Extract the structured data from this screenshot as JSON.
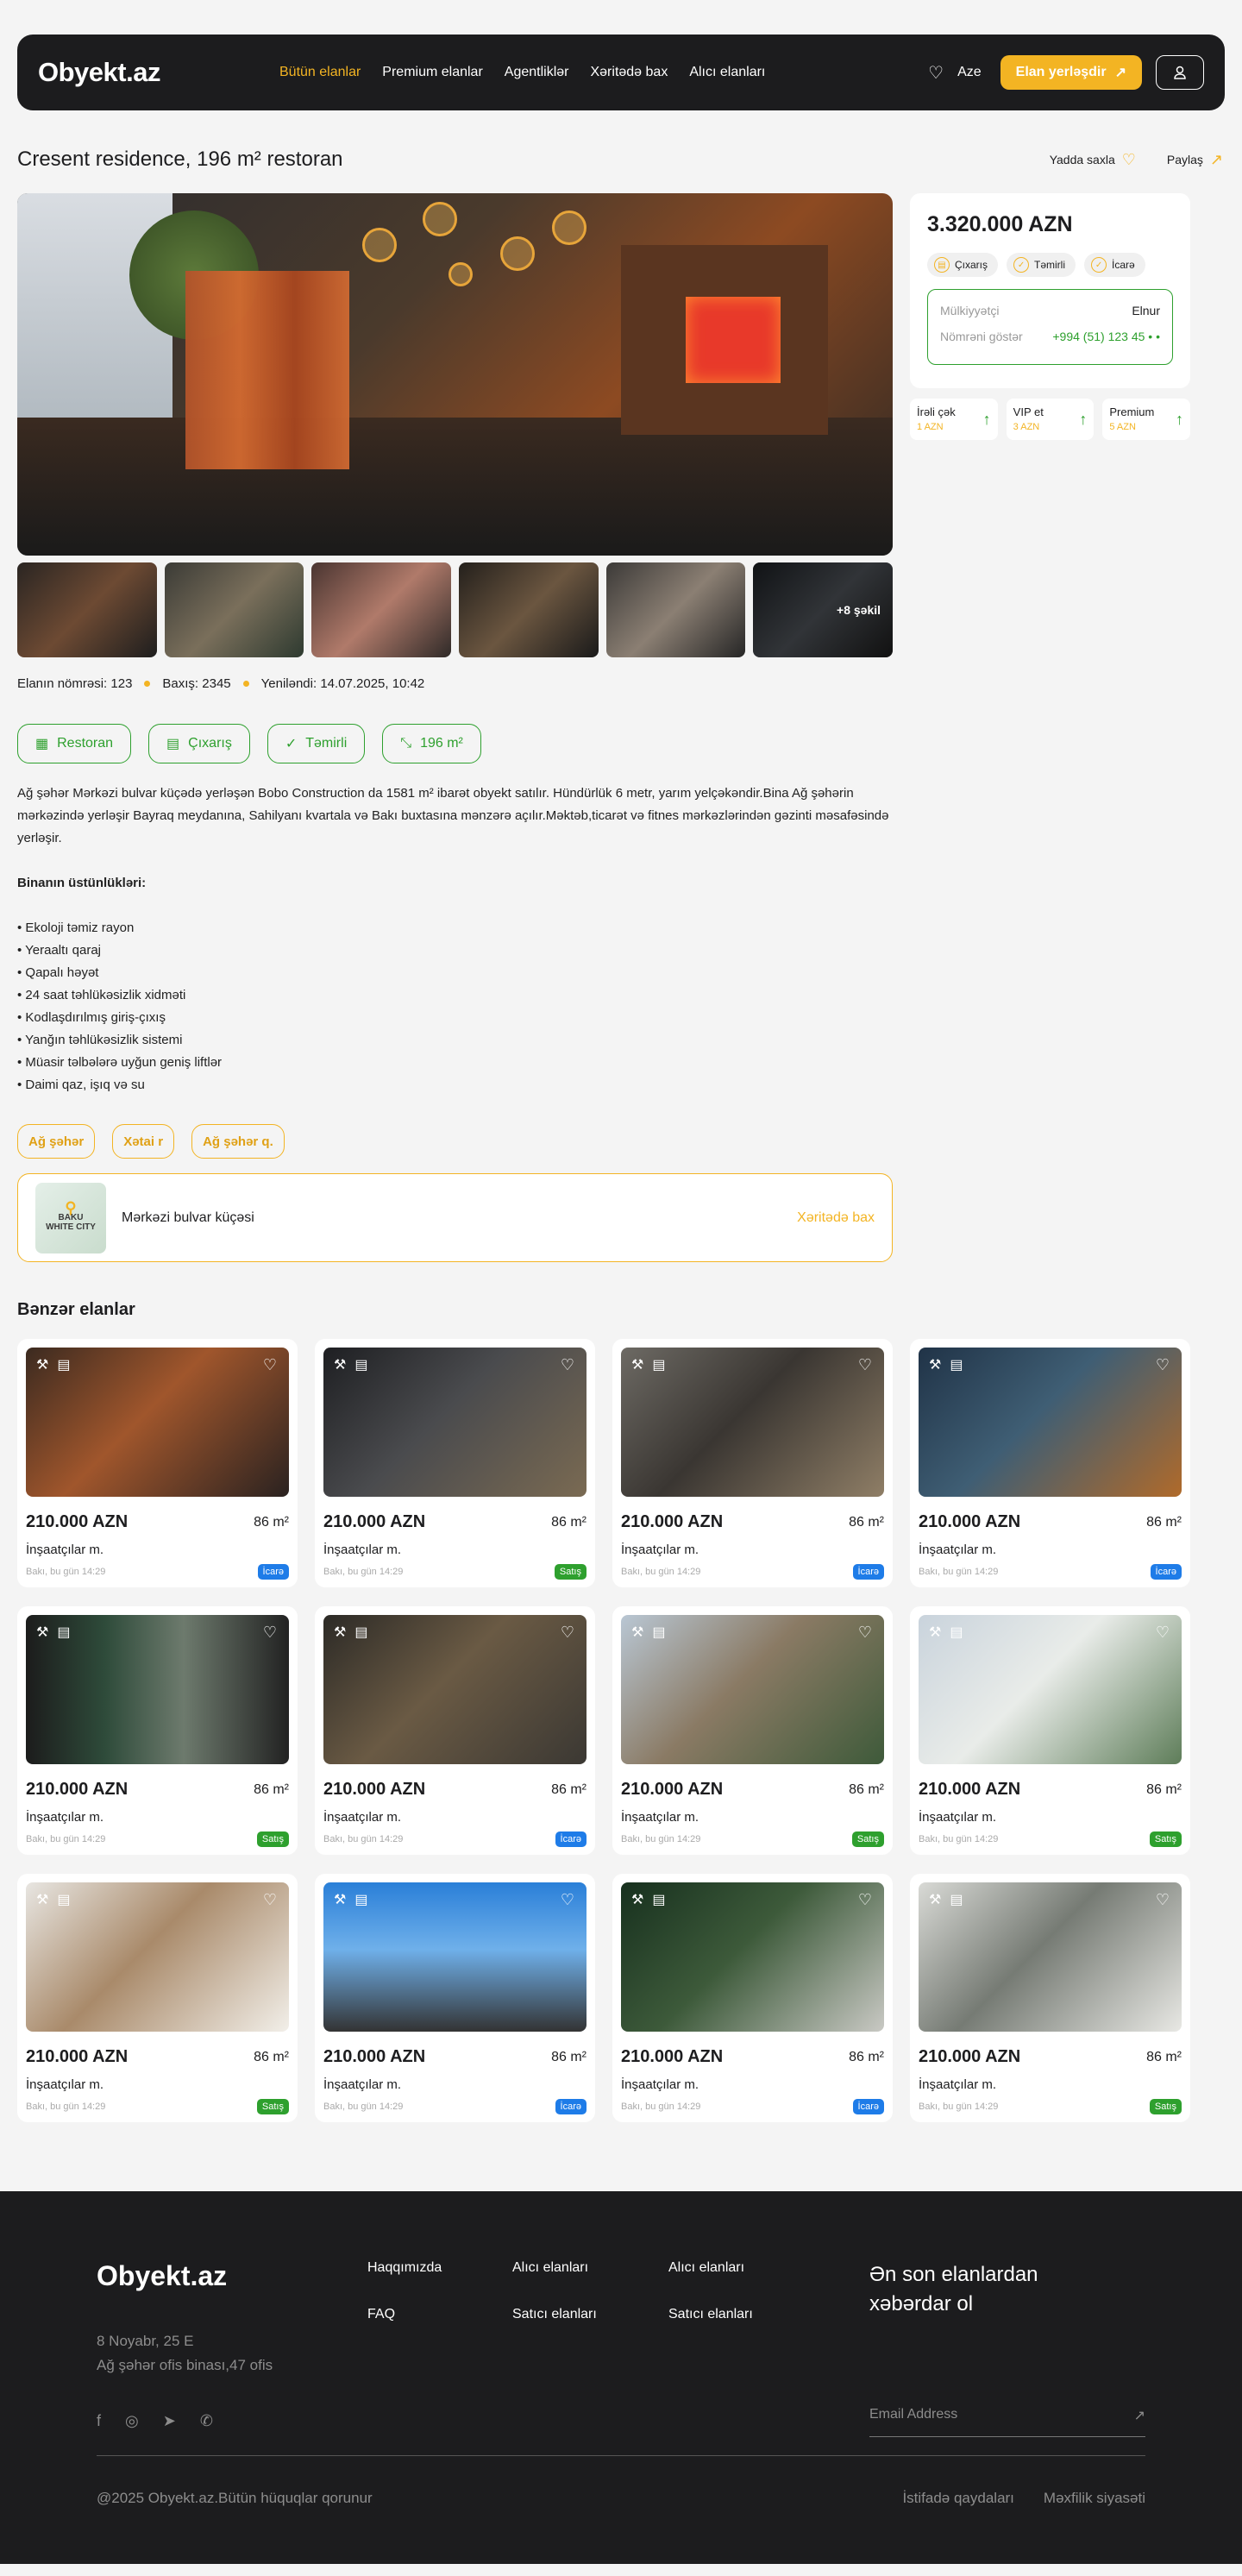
{
  "header": {
    "logo": "Obyekt.az",
    "nav": [
      "Bütün elanlar",
      "Premium elanlar",
      "Agentliklər",
      "Xəritədə bax",
      "Alıcı elanları"
    ],
    "lang": "Aze",
    "post_btn": "Elan yerləşdir"
  },
  "listing": {
    "title": "Cresent residence, 196 m² restoran",
    "save_label": "Yadda saxla",
    "share_label": "Paylaş",
    "more_photos": "+8 şəkil",
    "meta_number": "Elanın nömrəsi: 123",
    "meta_views": "Baxış: 2345",
    "meta_updated": "Yeniləndi: 14.07.2025, 10:42",
    "features": [
      "Restoran",
      "Çıxarış",
      "Təmirli",
      "196 m²"
    ],
    "description": "Ağ şəhər Mərkəzi bulvar küçədə yerləşən Bobo Construction da 1581 m² ibarət obyekt satılır. Hündürlük 6 metr, yarım yelçəkəndir.Bina Ağ şəhərin mərkəzində yerləşir Bayraq meydanına, Sahilyanı kvartala və Bakı buxtasına mənzərə açılır.Məktəb,ticarət və fitnes mərkəzlərindən gəzinti məsafəsində yerləşir.",
    "advantages_title": "Binanın üstünlükləri:",
    "advantages": [
      "• Ekoloji təmiz rayon",
      "• Yeraaltı qaraj",
      "• Qapalı həyət",
      "• 24 saat təhlükəsizlik xidməti",
      "• Kodlaşdırılmış giriş-çıxış",
      "• Yanğın təhlükəsizlik sistemi",
      "• Müasir təlbələrə uyğun geniş liftlər",
      "• Daimi qaz, işıq və su"
    ],
    "tags": [
      "Ağ şəhər",
      "Xətai r",
      "Ağ şəhər q."
    ],
    "map_thumb_text": "BAKU WHITE CITY",
    "address": "Mərkəzi bulvar küçəsi",
    "map_link": "Xəritədə bax"
  },
  "sidebar": {
    "price": "3.320.000 AZN",
    "pills": [
      "Çıxarış",
      "Təmirli",
      "İcarə"
    ],
    "owner_label": "Mülkiyyətçi",
    "owner_name": "Elnur",
    "phone_label": "Nömrəni göstər",
    "phone": "+994 (51) 123 45 • •",
    "promos": [
      {
        "name": "İrəli çək",
        "price": "1 AZN"
      },
      {
        "name": "VIP et",
        "price": "3 AZN"
      },
      {
        "name": "Premium",
        "price": "5 AZN"
      }
    ]
  },
  "similar": {
    "title": "Bənzər elanlar",
    "cards": [
      {
        "price": "210.000 AZN",
        "area": "86 m²",
        "name": "İnşaatçılar m.",
        "date": "Bakı, bu gün 14:29",
        "badge": "İcarə"
      },
      {
        "price": "210.000 AZN",
        "area": "86 m²",
        "name": "İnşaatçılar m.",
        "date": "Bakı, bu gün 14:29",
        "badge": "Satış"
      },
      {
        "price": "210.000 AZN",
        "area": "86 m²",
        "name": "İnşaatçılar m.",
        "date": "Bakı, bu gün 14:29",
        "badge": "İcarə"
      },
      {
        "price": "210.000 AZN",
        "area": "86 m²",
        "name": "İnşaatçılar m.",
        "date": "Bakı, bu gün 14:29",
        "badge": "İcarə"
      },
      {
        "price": "210.000 AZN",
        "area": "86 m²",
        "name": "İnşaatçılar m.",
        "date": "Bakı, bu gün 14:29",
        "badge": "Satış"
      },
      {
        "price": "210.000 AZN",
        "area": "86 m²",
        "name": "İnşaatçılar m.",
        "date": "Bakı, bu gün 14:29",
        "badge": "İcarə"
      },
      {
        "price": "210.000 AZN",
        "area": "86 m²",
        "name": "İnşaatçılar m.",
        "date": "Bakı, bu gün 14:29",
        "badge": "Satış"
      },
      {
        "price": "210.000 AZN",
        "area": "86 m²",
        "name": "İnşaatçılar m.",
        "date": "Bakı, bu gün 14:29",
        "badge": "Satış"
      },
      {
        "price": "210.000 AZN",
        "area": "86 m²",
        "name": "İnşaatçılar m.",
        "date": "Bakı, bu gün 14:29",
        "badge": "Satış"
      },
      {
        "price": "210.000 AZN",
        "area": "86 m²",
        "name": "İnşaatçılar m.",
        "date": "Bakı, bu gün 14:29",
        "badge": "İcarə"
      },
      {
        "price": "210.000 AZN",
        "area": "86 m²",
        "name": "İnşaatçılar m.",
        "date": "Bakı, bu gün 14:29",
        "badge": "İcarə"
      },
      {
        "price": "210.000 AZN",
        "area": "86 m²",
        "name": "İnşaatçılar m.",
        "date": "Bakı, bu gün 14:29",
        "badge": "Satış"
      }
    ]
  },
  "footer": {
    "logo": "Obyekt.az",
    "address_line1": "8 Noyabr, 25 E",
    "address_line2": "Ağ şəhər ofis binası,47 ofis",
    "col1": [
      "Haqqımızda",
      "FAQ"
    ],
    "col2": [
      "Alıcı elanları",
      "Satıcı elanları"
    ],
    "col3": [
      "Alıcı elanları",
      "Satıcı elanları"
    ],
    "newsletter": "Ən son elanlardan xəbərdar ol",
    "email_placeholder": "Email Address",
    "copyright": "@2025 Obyekt.az.Bütün hüquqlar qorunur",
    "links": [
      "İstifadə qaydaları",
      "Məxfilik siyasəti"
    ]
  },
  "colors": {
    "accent": "#f3b423",
    "green": "#2ea02e",
    "dark": "#1c1c1e",
    "satis": "#2ea02e",
    "icare": "#1e7ce8"
  }
}
